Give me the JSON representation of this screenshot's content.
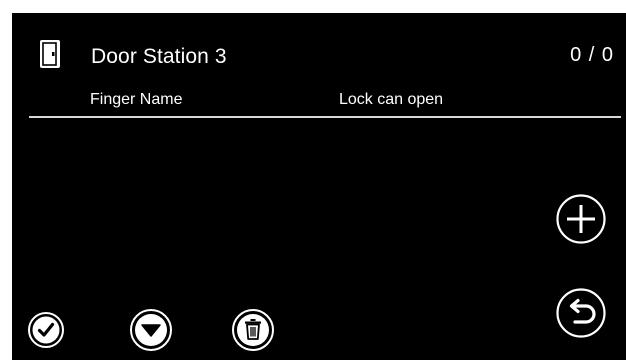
{
  "header": {
    "title": "Door Station 3",
    "counter": "0 / 0",
    "icon": "door-icon"
  },
  "table": {
    "columns": [
      "Finger Name",
      "Lock can open"
    ],
    "rows": []
  },
  "actions": {
    "add_icon": "plus-circle-icon",
    "back_icon": "return-arrow-icon",
    "confirm_icon": "checkmark-circle-icon",
    "down_icon": "down-triangle-circle-icon",
    "delete_icon": "trash-circle-icon"
  },
  "colors": {
    "background": "#000000",
    "foreground": "#ffffff",
    "divider": "#d8d8d8"
  }
}
